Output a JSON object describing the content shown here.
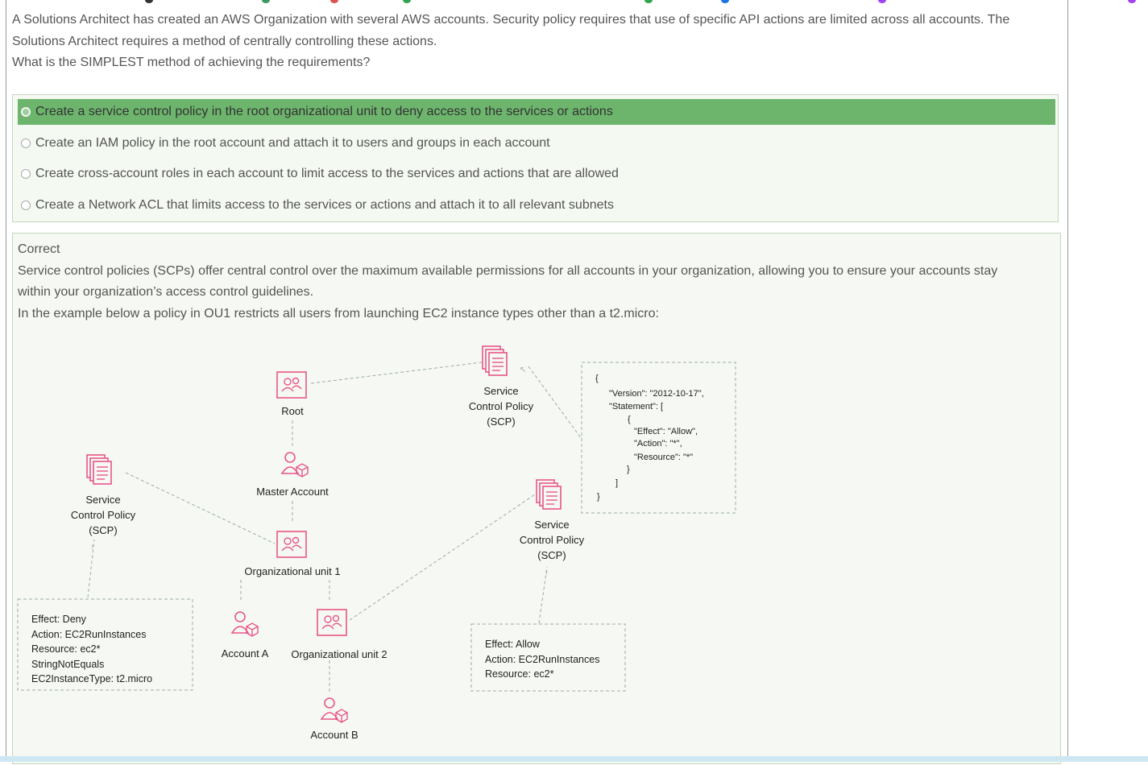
{
  "question": {
    "line1": "A Solutions Architect has created an AWS Organization with several AWS accounts. Security policy requires that use of specific API actions are limited across all accounts. The",
    "line2": "Solutions Architect requires a method of centrally controlling these actions.",
    "line3": "What is the SIMPLEST method of achieving the requirements?"
  },
  "answers": [
    {
      "label": "Create a service control policy in the root organizational unit to deny access to the services or actions",
      "correct": true
    },
    {
      "label": "Create an IAM policy in the root account and attach it to users and groups in each account",
      "correct": false
    },
    {
      "label": "Create cross-account roles in each account to limit access to the services and actions that are allowed",
      "correct": false
    },
    {
      "label": "Create a Network ACL that limits access to the services or actions and attach it to all relevant subnets",
      "correct": false
    }
  ],
  "explanation": {
    "status": "Correct",
    "line1": "Service control policies (SCPs) offer central control over the maximum available permissions for all accounts in your organization, allowing you to ensure your accounts stay",
    "line2": "within your organization’s access control guidelines.",
    "line3": "In the example below a policy in OU1 restricts all users from launching EC2 instance types other than a t2.micro:"
  },
  "diagram": {
    "root": "Root",
    "master": "Master Account",
    "ou1": "Organizational unit 1",
    "ou2": "Organizational unit 2",
    "account_a": "Account A",
    "account_b": "Account B",
    "scp_line1": "Service",
    "scp_line2": "Control Policy",
    "scp_line3": "(SCP)",
    "deny_box": [
      "Effect: Deny",
      "Action: EC2RunInstances",
      "Resource: ec2*",
      "StringNotEquals",
      "EC2InstanceType: t2.micro"
    ],
    "allow_box": [
      "Effect: Allow",
      "Action: EC2RunInstances",
      "Resource: ec2*"
    ],
    "json_box": [
      "{",
      "\"Version\": \"2012-10-17\",",
      "\"Statement\": [",
      "{",
      "\"Effect\": \"Allow\",",
      "\"Action\": \"*\",",
      "\"Resource\": \"*\"",
      "}",
      "]",
      "}"
    ],
    "colors": {
      "pink": "#e8568a",
      "correct_bg": "#6db56d"
    }
  }
}
